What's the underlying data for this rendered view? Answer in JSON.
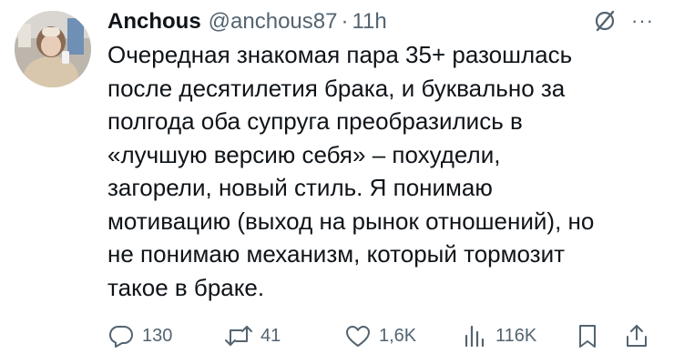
{
  "author": {
    "name": "Anchous",
    "handle": "@anchous87",
    "separator": "·",
    "time": "11h"
  },
  "icons": {
    "avatar": "profile-photo",
    "grok": "grok-slash-icon",
    "more": "more-horizontal-icon",
    "reply": "reply-bubble-icon",
    "retweet": "retweet-icon",
    "like": "heart-icon",
    "views": "bar-chart-icon",
    "bookmark": "bookmark-icon",
    "share": "share-arrow-icon"
  },
  "more_label": "···",
  "tweet_lines": [
    "Очередная знакомая пара 35+ разошлась",
    "после десятилетия брака, и буквально за",
    "полгода оба супруга преобразились в",
    "«лучшую версию себя» – похудели,",
    "загорели, новый стиль. Я понимаю",
    "мотивацию (выход на рынок отношений), но",
    "не понимаю механизм, который тормозит",
    "такое в браке."
  ],
  "stats": {
    "replies": "130",
    "retweets": "41",
    "likes": "1,6K",
    "views": "116K"
  },
  "colors": {
    "text": "#0f1419",
    "secondary": "#536471",
    "background": "#ffffff"
  }
}
